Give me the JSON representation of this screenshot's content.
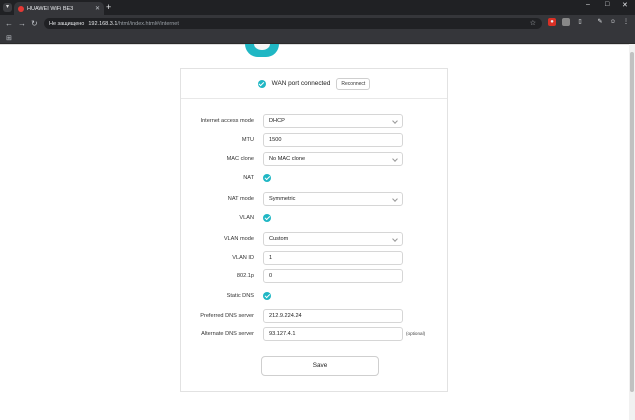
{
  "browser": {
    "tab_title": "HUAWEI WiFi BE3",
    "security_label": "Не защищено",
    "url_host": "192.168.3.1",
    "url_path": "/html/index.html#/internet",
    "apps_icon": "grid-icon"
  },
  "status": {
    "text": "WAN port connected",
    "reconnect_label": "Reconnect"
  },
  "form": {
    "access_mode": {
      "label": "Internet access mode",
      "value": "DHCP"
    },
    "mtu": {
      "label": "MTU",
      "value": "1500"
    },
    "mac_clone": {
      "label": "MAC clone",
      "value": "No MAC clone"
    },
    "nat": {
      "label": "NAT",
      "checked": true
    },
    "nat_mode": {
      "label": "NAT mode",
      "value": "Symmetric"
    },
    "vlan": {
      "label": "VLAN",
      "checked": true
    },
    "vlan_mode": {
      "label": "VLAN mode",
      "value": "Custom"
    },
    "vlan_id": {
      "label": "VLAN ID",
      "value": "1"
    },
    "p8021": {
      "label": "802.1p",
      "value": "0"
    },
    "static_dns": {
      "label": "Static DNS",
      "checked": true
    },
    "pref_dns": {
      "label": "Preferred DNS server",
      "value": "212.9.224.24"
    },
    "alt_dns": {
      "label": "Alternate DNS server",
      "value": "93.127.4.1",
      "note": "(optional)"
    }
  },
  "save_label": "Save",
  "colors": {
    "accent": "#20b7c4",
    "chrome": "#35363a"
  }
}
